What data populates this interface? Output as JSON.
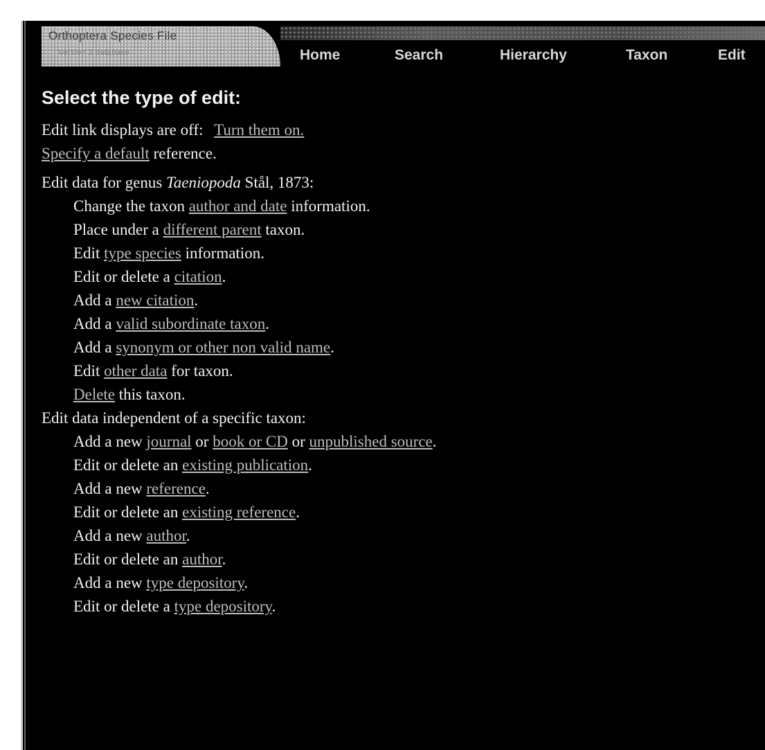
{
  "header": {
    "logo_title": "Orthoptera Species File",
    "logo_subtitle": "Version 2 database",
    "nav": [
      "Home",
      "Search",
      "Hierarchy",
      "Taxon",
      "Edit"
    ]
  },
  "page": {
    "heading": "Select the type of edit:",
    "edit_links_status": "Edit link displays are off:",
    "turn_on_link": "Turn them on.",
    "specify_default_link": "Specify a default",
    "specify_default_tail": " reference."
  },
  "genus": {
    "prefix": "Edit data for genus ",
    "name": "Taeniopoda",
    "suffix": " Stål, 1873:"
  },
  "taxon_actions": [
    {
      "pre": "Change the taxon ",
      "link": "author and date",
      "post": " information."
    },
    {
      "pre": "Place under a ",
      "link": "different parent",
      "post": " taxon."
    },
    {
      "pre": "Edit ",
      "link": "type species",
      "post": " information."
    },
    {
      "pre": "Edit or delete a ",
      "link": "citation",
      "post": "."
    },
    {
      "pre": "Add a ",
      "link": "new citation",
      "post": "."
    },
    {
      "pre": "Add a ",
      "link": "valid subordinate taxon",
      "post": "."
    },
    {
      "pre": "Add a ",
      "link": "synonym or other non valid name",
      "post": "."
    },
    {
      "pre": "Edit ",
      "link": "other data",
      "post": " for taxon."
    },
    {
      "pre": "",
      "link": "Delete",
      "post": " this taxon."
    }
  ],
  "independent": {
    "heading": "Edit data independent of a specific taxon:",
    "publication_line": {
      "pre": "Add a new ",
      "link1": "journal",
      "or1": " or ",
      "link2": "book or CD",
      "or2": " or ",
      "link3": "unpublished source",
      "post": "."
    },
    "actions": [
      {
        "pre": "Edit or delete an ",
        "link": "existing publication",
        "post": "."
      },
      {
        "pre": "Add a new ",
        "link": "reference",
        "post": "."
      },
      {
        "pre": "Edit or delete an ",
        "link": "existing reference",
        "post": "."
      },
      {
        "pre": "Add a new ",
        "link": "author",
        "post": "."
      },
      {
        "pre": "Edit or delete an ",
        "link": "author",
        "post": "."
      },
      {
        "pre": "Add a new ",
        "link": "type depository",
        "post": "."
      },
      {
        "pre": "Edit or delete a ",
        "link": "type depository",
        "post": "."
      }
    ]
  }
}
